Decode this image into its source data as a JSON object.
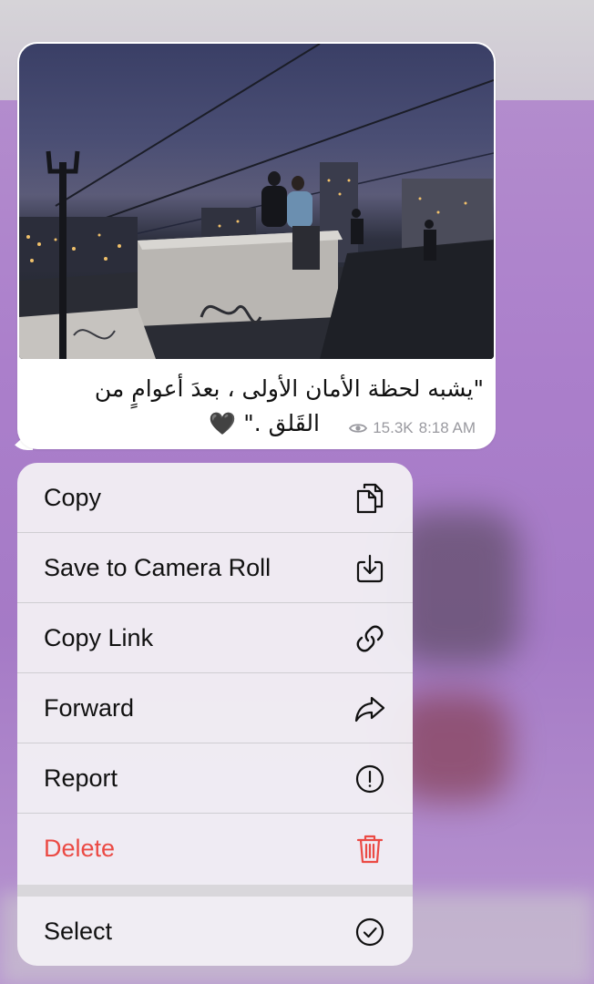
{
  "message": {
    "caption_line1": "\"يشبه لحظة الأمان الأولى ، بعدَ أعوامٍ من",
    "caption_line2": "القَلق .\"",
    "caption_emoji": "🖤",
    "views": "15.3K",
    "time": "8:18 AM"
  },
  "menu": {
    "items": [
      {
        "label": "Copy",
        "icon": "copy-icon"
      },
      {
        "label": "Save to Camera Roll",
        "icon": "download-icon"
      },
      {
        "label": "Copy Link",
        "icon": "link-icon"
      },
      {
        "label": "Forward",
        "icon": "forward-icon"
      },
      {
        "label": "Report",
        "icon": "exclamation-icon"
      },
      {
        "label": "Delete",
        "icon": "trash-icon",
        "color": "#eb4a44"
      },
      {
        "label": "Select",
        "icon": "checkmark-circle-icon"
      }
    ]
  },
  "colors": {
    "background": "#ab7fcb",
    "destructive": "#eb4a44",
    "meta_text": "#9a9aa0"
  }
}
